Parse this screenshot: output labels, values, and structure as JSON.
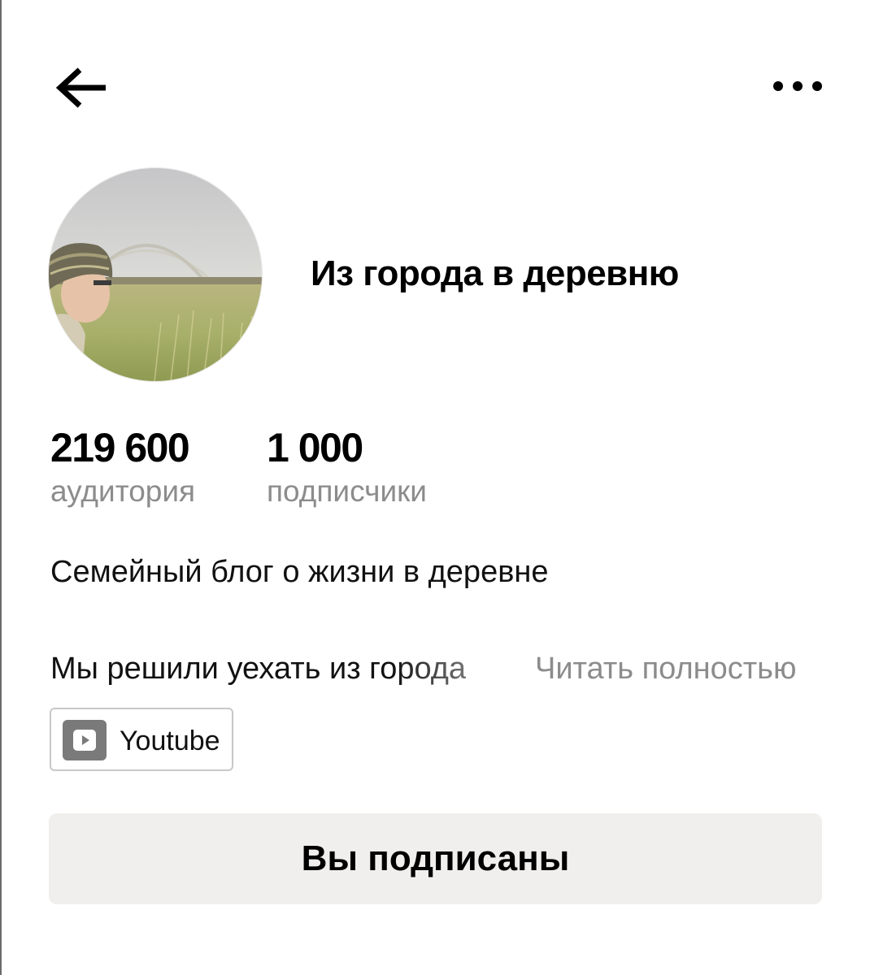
{
  "header": {
    "back_icon": "arrow-left-icon",
    "menu_icon": "more-horizontal-icon"
  },
  "channel": {
    "title": "Из города в деревню",
    "avatar": "avatar-photo"
  },
  "stats": [
    {
      "value": "219 600",
      "label": "аудитория"
    },
    {
      "value": "1 000",
      "label": "подписчики"
    }
  ],
  "tagline": "Семейный блог о жизни в деревне",
  "description": {
    "text": "Мы решили уехать из города",
    "read_more": "Читать полностью"
  },
  "links": [
    {
      "label": "Youtube",
      "icon": "youtube-icon"
    }
  ],
  "subscribe_button": {
    "label": "Вы подписаны"
  },
  "colors": {
    "secondary_text": "#8c8c8c",
    "button_background": "#f1efed",
    "chip_border": "#c8c8c8",
    "chip_icon_background": "#7a7a7a"
  }
}
